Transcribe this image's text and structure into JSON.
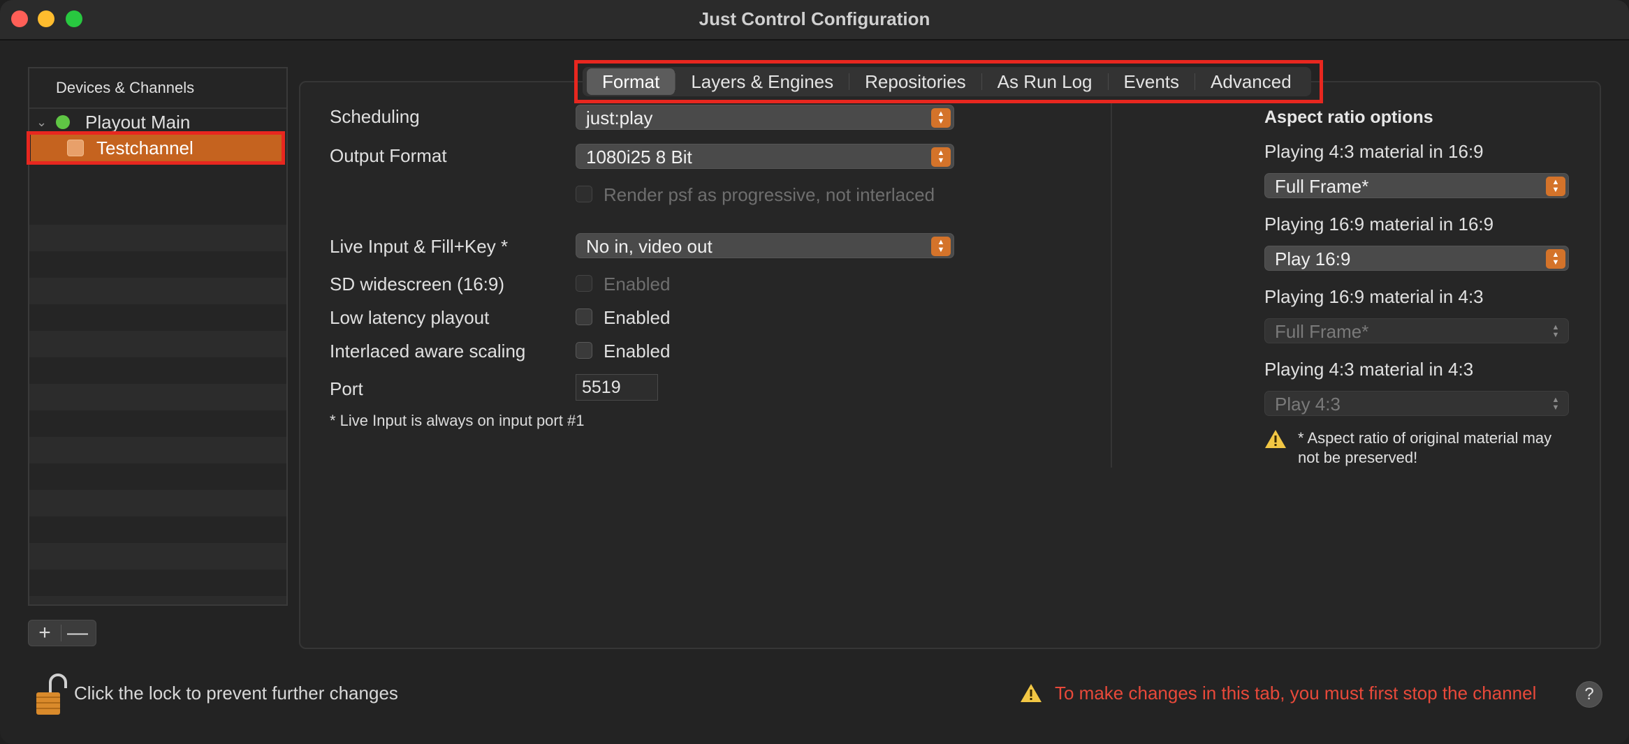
{
  "window": {
    "title": "Just Control Configuration"
  },
  "sidebar": {
    "header": "Devices & Channels",
    "items": [
      {
        "label": "Playout Main",
        "status": "green"
      },
      {
        "label": "Testchannel",
        "selected": true
      }
    ],
    "add_label": "+",
    "remove_label": "—"
  },
  "tabs": [
    {
      "label": "Format",
      "active": true
    },
    {
      "label": "Layers & Engines"
    },
    {
      "label": "Repositories"
    },
    {
      "label": "As Run Log"
    },
    {
      "label": "Events"
    },
    {
      "label": "Advanced"
    }
  ],
  "format": {
    "scheduling": {
      "label": "Scheduling",
      "value": "just:play"
    },
    "output_format": {
      "label": "Output Format",
      "value": "1080i25 8 Bit"
    },
    "render_psf": {
      "label": "Render psf as progressive, not interlaced",
      "checked": false,
      "enabled": false
    },
    "live_input": {
      "label": "Live Input & Fill+Key *",
      "value": "No in, video out"
    },
    "sd_widescreen": {
      "label": "SD widescreen (16:9)",
      "checkbox_label": "Enabled",
      "checked": false,
      "enabled": false
    },
    "low_latency": {
      "label": "Low latency playout",
      "checkbox_label": "Enabled",
      "checked": false
    },
    "interlaced_scaling": {
      "label": "Interlaced aware scaling",
      "checkbox_label": "Enabled",
      "checked": false
    },
    "port": {
      "label": "Port",
      "value": "5519"
    },
    "note": "* Live Input is always on input port #1"
  },
  "aspect": {
    "title": "Aspect ratio options",
    "options": [
      {
        "label": "Playing 4:3 material in 16:9",
        "value": "Full Frame*",
        "enabled": true
      },
      {
        "label": "Playing 16:9 material in 16:9",
        "value": "Play 16:9",
        "enabled": true
      },
      {
        "label": "Playing 16:9 material in 4:3",
        "value": "Full Frame*",
        "enabled": false
      },
      {
        "label": "Playing 4:3 material in 4:3",
        "value": "Play 4:3",
        "enabled": false
      }
    ],
    "warning": "* Aspect ratio of original material may not be preserved!"
  },
  "footer": {
    "lock_text": "Click the lock to prevent further changes",
    "warning_text": "To make changes in this tab, you must first stop the channel",
    "help_label": "?"
  },
  "colors": {
    "accent": "#d4732a",
    "selection": "#c5631f",
    "warning_text": "#e8493a",
    "highlight": "#e8271f",
    "status_green": "#5fc544"
  }
}
